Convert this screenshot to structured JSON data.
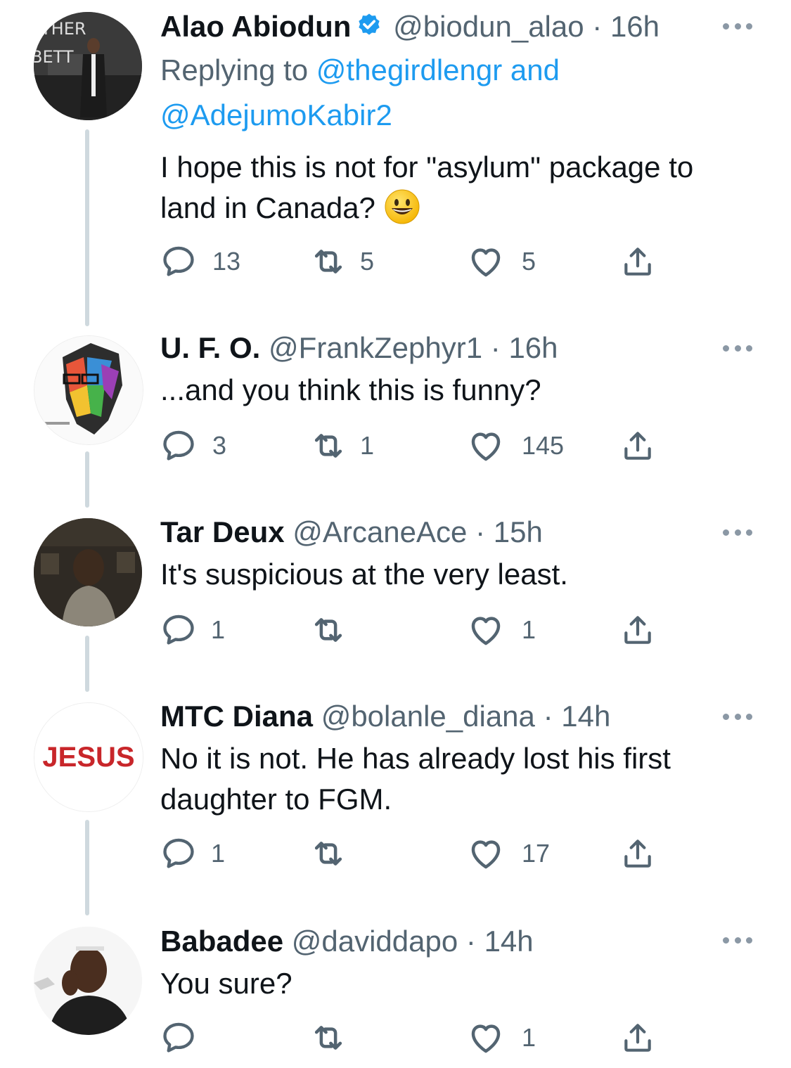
{
  "tweets": [
    {
      "name": "Alao Abiodun",
      "verified": true,
      "handle": "@biodun_alao",
      "time": "16h",
      "replying_prefix": "Replying to ",
      "replying_to_1": "@thegirdlengr and",
      "replying_to_2": "@AdejumoKabir2",
      "text_line1": "I hope this is not for \"asylum\" package to",
      "text_line2": "land in Canada?",
      "emoji": "grinning-face",
      "replies": "13",
      "retweets": "5",
      "likes": "5",
      "avatar_text": "THER BETT"
    },
    {
      "name": "U. F. O.",
      "handle": "@FrankZephyr1",
      "time": "16h",
      "text": "...and you think this is funny?",
      "replies": "3",
      "retweets": "1",
      "likes": "145"
    },
    {
      "name": "Tar Deux",
      "handle": "@ArcaneAce",
      "time": "15h",
      "text": "It's suspicious at the very least.",
      "replies": "1",
      "retweets": "",
      "likes": "1"
    },
    {
      "name": "MTC Diana",
      "handle": "@bolanle_diana",
      "time": "14h",
      "text_line1": "No it is not. He has already lost his first",
      "text_line2": "daughter to FGM.",
      "replies": "1",
      "retweets": "",
      "likes": "17",
      "avatar_text": "JESUS"
    },
    {
      "name": "Babadee",
      "handle": "@daviddapo",
      "time": "14h",
      "text": "You sure?",
      "replies": "",
      "retweets": "",
      "likes": "1"
    }
  ],
  "separator": "·",
  "colors": {
    "link": "#1d9bf0",
    "secondary": "#536471",
    "thread_line": "#cfd9de",
    "verified": "#1d9bf0"
  }
}
